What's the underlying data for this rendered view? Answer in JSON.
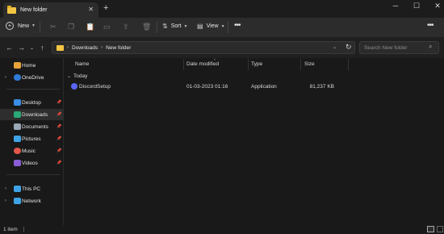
{
  "window": {
    "tab_title": "New folder",
    "tab_close": "✕",
    "new_tab": "+",
    "minimize": "─",
    "maximize": "☐",
    "close": "✕"
  },
  "toolbar": {
    "new_label": "New",
    "sort_label": "Sort",
    "view_label": "View",
    "more": "•••"
  },
  "address": {
    "crumbs": [
      "Downloads",
      "New folder"
    ],
    "search_placeholder": "Search New folder"
  },
  "sidebar": {
    "items": [
      {
        "label": "Home",
        "icon": "home-icon",
        "color": "#e8a33a"
      },
      {
        "label": "OneDrive",
        "icon": "cloud-icon",
        "color": "#2f7bd6"
      },
      {
        "label": "Desktop",
        "icon": "desktop-icon",
        "color": "#3a8ee6"
      },
      {
        "label": "Downloads",
        "icon": "download-icon",
        "color": "#2aa876"
      },
      {
        "label": "Documents",
        "icon": "document-icon",
        "color": "#9aa7b5"
      },
      {
        "label": "Pictures",
        "icon": "picture-icon",
        "color": "#3fa3e8"
      },
      {
        "label": "Music",
        "icon": "music-icon",
        "color": "#e2574c"
      },
      {
        "label": "Videos",
        "icon": "video-icon",
        "color": "#8a5cd6"
      },
      {
        "label": "This PC",
        "icon": "computer-icon",
        "color": "#3fa3e8"
      },
      {
        "label": "Network",
        "icon": "network-icon",
        "color": "#3fa3e8"
      }
    ]
  },
  "columns": [
    "Name",
    "Date modified",
    "Type",
    "Size"
  ],
  "group": "Today",
  "files": [
    {
      "name": "DiscordSetup",
      "date": "01-03-2023 01:16",
      "type": "Application",
      "size": "81,237 KB",
      "icon_color": "#5865f2"
    }
  ],
  "status": {
    "count": "1 item"
  }
}
